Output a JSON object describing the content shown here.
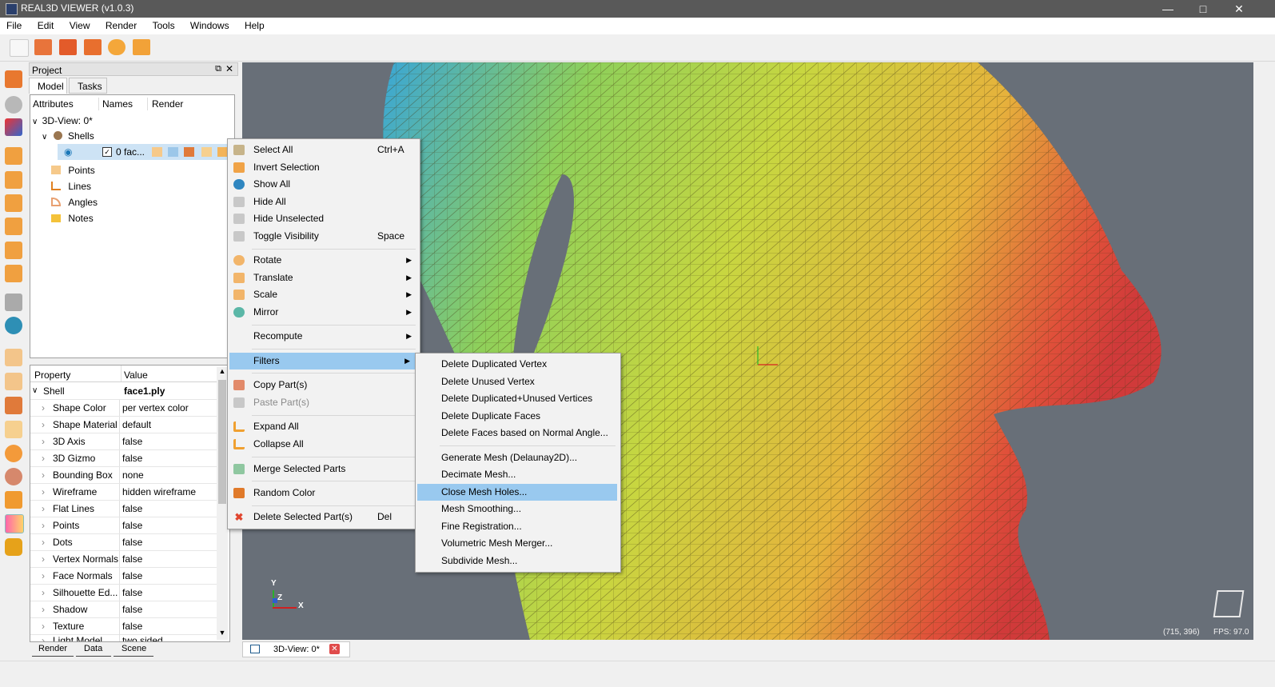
{
  "window": {
    "title": "REAL3D VIEWER (v1.0.3)",
    "min_icon": "minimize-icon",
    "max_icon": "maximize-icon",
    "close_icon": "close-icon"
  },
  "menubar": {
    "items": [
      "File",
      "Edit",
      "View",
      "Render",
      "Tools",
      "Windows",
      "Help"
    ]
  },
  "project_panel": {
    "title": "Project",
    "tabs": [
      "Model",
      "Tasks"
    ],
    "tree_headers": [
      "Attributes",
      "Names",
      "Render"
    ],
    "tree": {
      "root": "3D-View: 0*",
      "shells": "Shells",
      "shell_item": "0 fac...",
      "items": [
        "Points",
        "Lines",
        "Angles",
        "Notes"
      ]
    }
  },
  "properties": {
    "headers": [
      "Property",
      "Value"
    ],
    "group": {
      "name": "Shell",
      "value": "face1.ply"
    },
    "rows": [
      {
        "name": "Shape Color",
        "value": "per vertex color"
      },
      {
        "name": "Shape Material",
        "value": "default"
      },
      {
        "name": "3D Axis",
        "value": "false"
      },
      {
        "name": "3D Gizmo",
        "value": "false"
      },
      {
        "name": "Bounding Box",
        "value": "none"
      },
      {
        "name": "Wireframe",
        "value": "hidden wireframe"
      },
      {
        "name": "Flat Lines",
        "value": "false"
      },
      {
        "name": "Points",
        "value": "false"
      },
      {
        "name": "Dots",
        "value": "false"
      },
      {
        "name": "Vertex Normals",
        "value": "false"
      },
      {
        "name": "Face Normals",
        "value": "false"
      },
      {
        "name": "Silhouette Ed...",
        "value": "false"
      },
      {
        "name": "Shadow",
        "value": "false"
      },
      {
        "name": "Texture",
        "value": "false"
      },
      {
        "name": "Light Model",
        "value": "two sided"
      }
    ]
  },
  "bottom_tabs": [
    "Render",
    "Data",
    "Scene"
  ],
  "viewport": {
    "tab_label": "3D-View: 0*",
    "coords": "(715, 396)",
    "fps": "FPS: 97.0",
    "axes": {
      "x": "X",
      "y": "Y",
      "z": "Z"
    }
  },
  "context_menu": {
    "items": [
      {
        "label": "Select All",
        "shortcut": "Ctrl+A"
      },
      {
        "label": "Invert Selection",
        "shortcut": ""
      },
      {
        "label": "Show All",
        "shortcut": ""
      },
      {
        "label": "Hide All",
        "shortcut": ""
      },
      {
        "label": "Hide Unselected",
        "shortcut": ""
      },
      {
        "label": "Toggle Visibility",
        "shortcut": "Space"
      },
      {
        "label": "Rotate",
        "shortcut": ""
      },
      {
        "label": "Translate",
        "shortcut": ""
      },
      {
        "label": "Scale",
        "shortcut": ""
      },
      {
        "label": "Mirror",
        "shortcut": ""
      },
      {
        "label": "Recompute",
        "shortcut": ""
      },
      {
        "label": "Filters",
        "shortcut": ""
      },
      {
        "label": "Copy Part(s)",
        "shortcut": ""
      },
      {
        "label": "Paste Part(s)",
        "shortcut": ""
      },
      {
        "label": "Expand All",
        "shortcut": ""
      },
      {
        "label": "Collapse All",
        "shortcut": ""
      },
      {
        "label": "Merge Selected Parts",
        "shortcut": ""
      },
      {
        "label": "Random Color",
        "shortcut": ""
      },
      {
        "label": "Delete Selected Part(s)",
        "shortcut": "Del"
      }
    ]
  },
  "filters_submenu": {
    "items": [
      "Delete Duplicated Vertex",
      "Delete Unused Vertex",
      "Delete Duplicated+Unused Vertices",
      "Delete Duplicate Faces",
      "Delete Faces based on Normal Angle...",
      "Generate Mesh (Delaunay2D)...",
      "Decimate Mesh...",
      "Close Mesh Holes...",
      "Mesh Smoothing...",
      "Fine Registration...",
      "Volumetric Mesh Merger...",
      "Subdivide Mesh..."
    ]
  },
  "colors": {
    "highlight": "#99c9ef",
    "titlebar": "#595959",
    "viewport_bg": "#686f78"
  }
}
